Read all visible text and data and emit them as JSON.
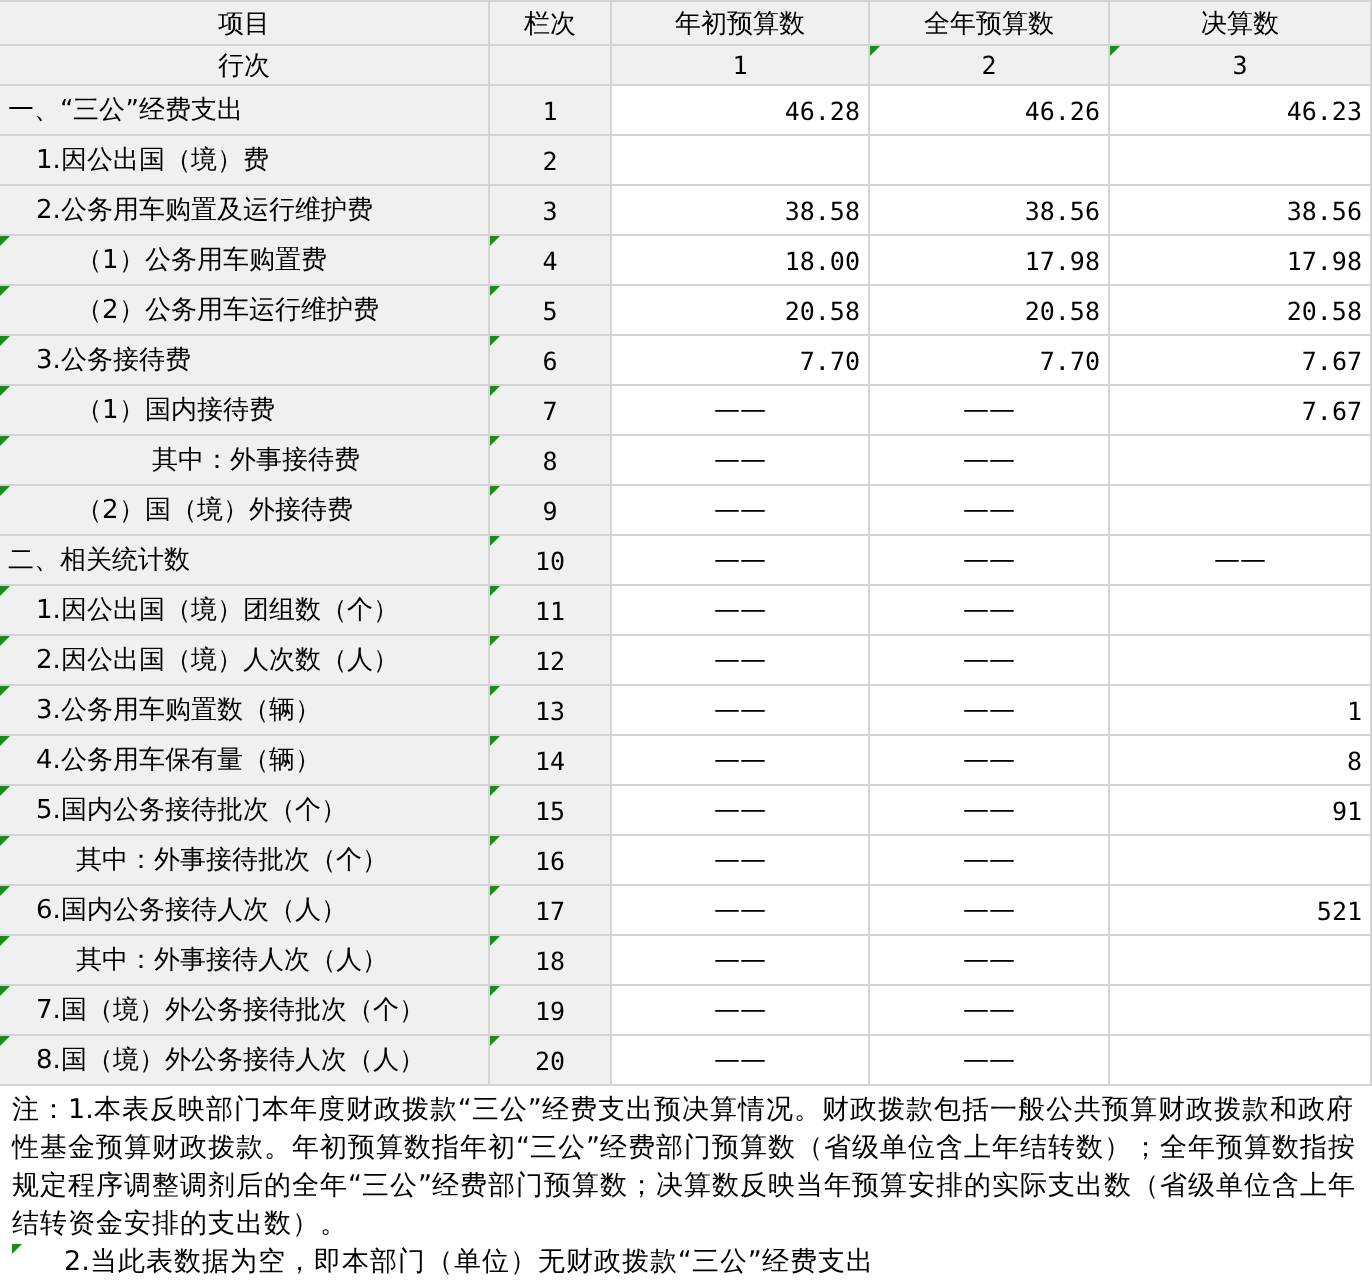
{
  "columns": [
    {
      "label": "项目"
    },
    {
      "label": "栏次"
    },
    {
      "label": "年初预算数"
    },
    {
      "label": "全年预算数"
    },
    {
      "label": "决算数"
    }
  ],
  "index_row": [
    {
      "text": "行次",
      "flag": false
    },
    {
      "flag": false
    },
    {
      "text": "1",
      "flag": false
    },
    {
      "text": "2",
      "flag": true
    },
    {
      "text": "3",
      "flag": true
    }
  ],
  "rows": [
    {
      "kind": "section",
      "item": "一、“三公”经费支出",
      "no": "1",
      "item_flag": false,
      "no_flag": false,
      "initial": "46.28",
      "full_year": "46.26",
      "final": "46.23"
    },
    {
      "kind": "level1",
      "item": "1.因公出国（境）费",
      "no": "2",
      "item_flag": false,
      "no_flag": false
    },
    {
      "kind": "level1",
      "item": "2.公务用车购置及运行维护费",
      "no": "3",
      "item_flag": false,
      "no_flag": false,
      "initial": "38.58",
      "full_year": "38.56",
      "final": "38.56"
    },
    {
      "kind": "level2",
      "item": "（1）公务用车购置费",
      "no": "4",
      "item_flag": true,
      "no_flag": true,
      "initial": "18.00",
      "full_year": "17.98",
      "final": "17.98"
    },
    {
      "kind": "level2",
      "item": "（2）公务用车运行维护费",
      "no": "5",
      "item_flag": true,
      "no_flag": true,
      "initial": "20.58",
      "full_year": "20.58",
      "final": "20.58"
    },
    {
      "kind": "level1",
      "item": "3.公务接待费",
      "no": "6",
      "item_flag": true,
      "no_flag": true,
      "initial": "7.70",
      "full_year": "7.70",
      "final": "7.67"
    },
    {
      "kind": "level2",
      "item": "（1）国内接待费",
      "no": "7",
      "item_flag": true,
      "no_flag": true,
      "initial": "——",
      "full_year": "——",
      "final": "7.67"
    },
    {
      "kind": "level3",
      "item": "其中：外事接待费",
      "no": "8",
      "item_flag": true,
      "no_flag": true,
      "initial": "——",
      "full_year": "——"
    },
    {
      "kind": "level2",
      "item": "（2）国（境）外接待费",
      "no": "9",
      "item_flag": true,
      "no_flag": true,
      "initial": "——",
      "full_year": "——"
    },
    {
      "kind": "section",
      "item": "二、相关统计数",
      "no": "10",
      "item_flag": false,
      "no_flag": true,
      "initial": "——",
      "full_year": "——",
      "final": "——"
    },
    {
      "kind": "level1",
      "item": "1.因公出国（境）团组数（个）",
      "no": "11",
      "item_flag": true,
      "no_flag": true,
      "initial": "——",
      "full_year": "——"
    },
    {
      "kind": "level1",
      "item": "2.因公出国（境）人次数（人）",
      "no": "12",
      "item_flag": true,
      "no_flag": true,
      "initial": "——",
      "full_year": "——"
    },
    {
      "kind": "level1",
      "item": "3.公务用车购置数（辆）",
      "no": "13",
      "item_flag": true,
      "no_flag": true,
      "initial": "——",
      "full_year": "——",
      "final": "1"
    },
    {
      "kind": "level1",
      "item": "4.公务用车保有量（辆）",
      "no": "14",
      "item_flag": true,
      "no_flag": true,
      "initial": "——",
      "full_year": "——",
      "final": "8"
    },
    {
      "kind": "level1",
      "item": "5.国内公务接待批次（个）",
      "no": "15",
      "item_flag": true,
      "no_flag": true,
      "initial": "——",
      "full_year": "——",
      "final": "91"
    },
    {
      "kind": "level2",
      "item": "其中：外事接待批次（个）",
      "no": "16",
      "item_flag": true,
      "no_flag": true,
      "initial": "——",
      "full_year": "——"
    },
    {
      "kind": "level1",
      "item": "6.国内公务接待人次（人）",
      "no": "17",
      "item_flag": true,
      "no_flag": true,
      "initial": "——",
      "full_year": "——",
      "final": "521"
    },
    {
      "kind": "level2",
      "item": "其中：外事接待人次（人）",
      "no": "18",
      "item_flag": true,
      "no_flag": true,
      "initial": "——",
      "full_year": "——"
    },
    {
      "kind": "level1",
      "item": "7.国（境）外公务接待批次（个）",
      "no": "19",
      "item_flag": true,
      "no_flag": true,
      "initial": "——",
      "full_year": "——"
    },
    {
      "kind": "level1",
      "item": "8.国（境）外公务接待人次（人）",
      "no": "20",
      "item_flag": true,
      "no_flag": true,
      "initial": "——",
      "full_year": "——"
    }
  ],
  "notes": [
    {
      "text": "注：1.本表反映部门本年度财政拨款“三公”经费支出预决算情况。财政拨款包括一般公共预算财政拨款和政府性基金预算财政拨款。年初预算数指年初“三公”经费部门预算数（省级单位含上年结转数）；全年预算数指按规定程序调整调剂后的全年“三公”经费部门预算数；决算数反映当年预算安排的实际支出数（省级单位含上年结转资金安排的支出数）。",
      "flag": false
    },
    {
      "text": "2.当此表数据为空，即本部门（单位）无财政拨款“三公”经费支出",
      "flag": true
    }
  ]
}
